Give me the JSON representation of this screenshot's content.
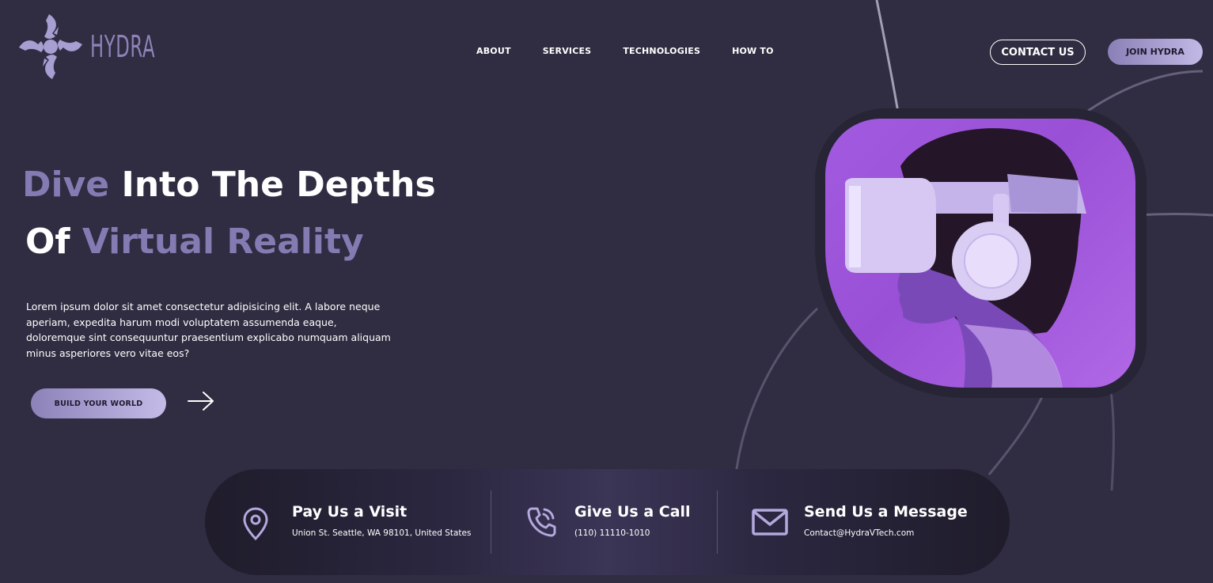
{
  "brand": {
    "name": "HYDRA"
  },
  "nav": {
    "items": [
      "ABOUT",
      "SERVICES",
      "TECHNOLOGIES",
      "HOW TO"
    ]
  },
  "header": {
    "contact_label": "CONTACT US",
    "join_label": "JOIN HYDRA"
  },
  "hero": {
    "line1_accent": "Dive",
    "line1_rest": "Into The Depths",
    "line2_start": "Of",
    "line2_accent": "Virtual Reality",
    "body": "Lorem ipsum dolor sit amet consectetur adipisicing elit. A labore neque aperiam, expedita harum modi voluptatem assumenda eaque, doloremque sint consequuntur praesentium explicabo numquam aliquam minus asperiores vero vitae eos?",
    "cta_label": "BUILD YOUR WORLD"
  },
  "contact": {
    "visit": {
      "title": "Pay Us a Visit",
      "detail": "Union St. Seattle, WA 98101, United States"
    },
    "call": {
      "title": "Give Us a Call",
      "detail": "(110) 11110-1010"
    },
    "message": {
      "title": "Send Us a Message",
      "detail": "Contact@HydraVTech.com"
    }
  },
  "colors": {
    "background": "#302c41",
    "accent": "#857bb3",
    "card": "#a25be0"
  },
  "icons": [
    "hydra-logo-icon",
    "arrow-right-icon",
    "location-pin-icon",
    "phone-icon",
    "mail-icon"
  ]
}
